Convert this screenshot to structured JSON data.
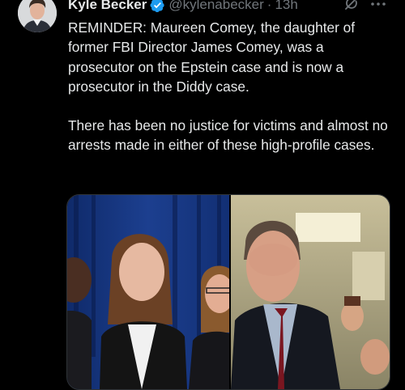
{
  "author": {
    "display_name": "Kyle Becker",
    "handle": "@kylenabecker",
    "separator": "·",
    "timestamp": "13h",
    "verified_icon": "verified-badge-icon"
  },
  "tweet": {
    "paragraphs": [
      "REMINDER: Maureen Comey, the daughter of former FBI Director James Comey, was a prosecutor on the Epstein case and is now a prosecutor in the Diddy case.",
      "There has been no justice for victims and almost no arrests made in either of these high-profile cases."
    ]
  },
  "actions": {
    "grok_icon": "grok-icon",
    "more_icon": "more-options-icon"
  },
  "colors": {
    "background": "#000000",
    "text_primary": "#e7e9ea",
    "text_secondary": "#71767b",
    "verified_blue": "#1d9bf0"
  }
}
